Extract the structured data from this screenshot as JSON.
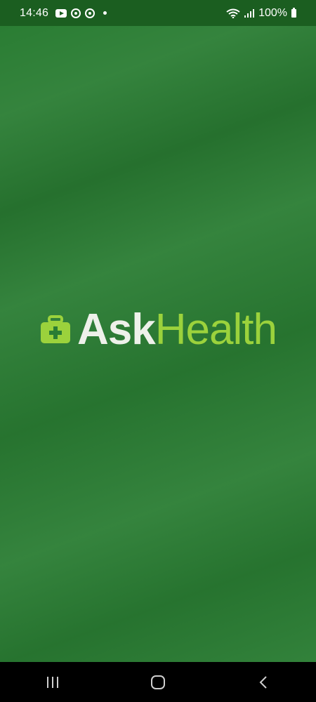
{
  "status_bar": {
    "time": "14:46",
    "battery": "100%",
    "icons": [
      "youtube-icon",
      "ring-icon",
      "ring-icon",
      "dot-icon",
      "wifi-icon",
      "signal-icon",
      "battery-icon"
    ]
  },
  "splash": {
    "brand_part1": "Ask",
    "brand_part2": "Health",
    "colors": {
      "background": "#2a7d33",
      "brand_part1": "#eef1ea",
      "brand_part2": "#9bd23c",
      "icon": "#9bd23c"
    }
  },
  "nav_bar": {
    "icons": [
      "recent-apps-icon",
      "home-icon",
      "back-icon"
    ]
  }
}
